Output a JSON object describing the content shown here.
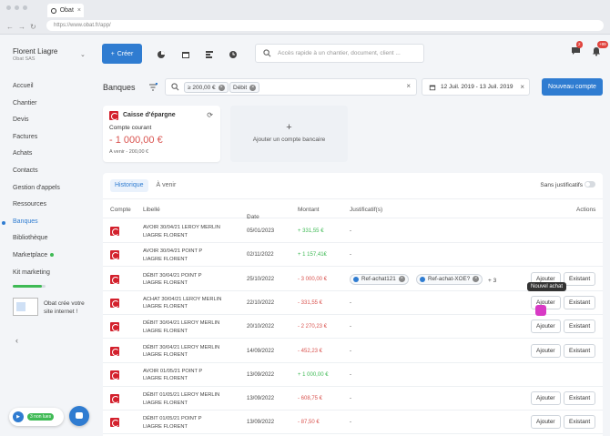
{
  "browser": {
    "tab_title": "Obat",
    "url": "https://www.obat.fr/app/"
  },
  "user": {
    "name": "Florent Liagre",
    "company": "Obat SAS"
  },
  "nav": [
    {
      "label": "Accueil"
    },
    {
      "label": "Chantier"
    },
    {
      "label": "Devis"
    },
    {
      "label": "Factures"
    },
    {
      "label": "Achats"
    },
    {
      "label": "Contacts"
    },
    {
      "label": "Gestion d'appels"
    },
    {
      "label": "Ressources"
    },
    {
      "label": "Banques"
    },
    {
      "label": "Bibliothèque"
    },
    {
      "label": "Marketplace"
    },
    {
      "label": "Kit marketing"
    }
  ],
  "kit_progress": 0.9,
  "promo": "Obat crée votre site internet !",
  "chat": {
    "badge": "3 non lues"
  },
  "topbar": {
    "create": "Créer",
    "search_placeholder": "Accès rapide à un chantier, document, client ...",
    "messages_badge": "2",
    "notif_badge": "+99"
  },
  "page": {
    "title": "Banques",
    "new_account": "Nouveau compte",
    "date_range": "12 Juil. 2019 - 13 Juil. 2019"
  },
  "filters": [
    {
      "label": "≥ 200,00 €"
    },
    {
      "label": "Débit"
    }
  ],
  "account_card": {
    "bank": "Caisse d'épargne",
    "type": "Compte courant",
    "balance": "- 1 000,00 €",
    "upcoming": "A venir - 200,00 €"
  },
  "add_card": {
    "label": "Ajouter un compte bancaire"
  },
  "tabs": {
    "history": "Historique",
    "upcoming": "À venir",
    "toggle_label": "Sans justificatifs"
  },
  "columns": {
    "account": "Compte",
    "label": "Libellé",
    "date": "Date",
    "amount": "Montant",
    "proof": "Justificatif(s)",
    "actions": "Actions"
  },
  "rows": [
    {
      "l1": "AVOIR 30/04/21 LEROY MERLIN",
      "l2": "LIAGRE FLORENT",
      "date": "05/01/2023",
      "amount": "+ 331,55 €",
      "proof": "-"
    },
    {
      "l1": "AVOIR 30/04/21 POINT P",
      "l2": "LIAGRE FLORENT",
      "date": "02/11/2022",
      "amount": "+ 1 157,41€",
      "proof": "-"
    },
    {
      "l1": "DÉBIT 30/04/21 POINT P",
      "l2": "LIAGRE FLORENT",
      "date": "25/10/2022",
      "amount": "- 3 000,00 €",
      "chip1": "Ref-achat121",
      "chip2": "Ref-achat-XOE?",
      "more": "+ 3",
      "add": "Ajouter",
      "existing": "Existant"
    },
    {
      "l1": "ACHAT 30/04/21 LEROY MERLIN",
      "l2": "LIAGRE FLORENT",
      "date": "22/10/2022",
      "amount": "- 331,55 €",
      "proof": "-",
      "add": "Ajouter",
      "existing": "Existant"
    },
    {
      "l1": "DÉBIT 30/04/21 LEROY MERLIN",
      "l2": "LIAGRE FLORENT",
      "date": "20/10/2022",
      "amount": "- 2 270,23 €",
      "proof": "-",
      "add": "Ajouter",
      "existing": "Existant"
    },
    {
      "l1": "DÉBIT 30/04/21 LEROY MERLIN",
      "l2": "LIAGRE FLORENT",
      "date": "14/09/2022",
      "amount": "- 452,23 €",
      "proof": "-",
      "add": "Ajouter",
      "existing": "Existant"
    },
    {
      "l1": "AVOIR 01/05/21 POINT P",
      "l2": "LIAGRE FLORENT",
      "date": "13/09/2022",
      "amount": "+ 1 000,00 €",
      "proof": "-"
    },
    {
      "l1": "DÉBIT 01/05/21 LEROY MERLIN",
      "l2": "LIAGRE FLORENT",
      "date": "13/09/2022",
      "amount": "- 608,75 €",
      "proof": "-",
      "add": "Ajouter",
      "existing": "Existant"
    },
    {
      "l1": "DÉBIT 01/05/21 POINT P",
      "l2": "LIAGRE FLORENT",
      "date": "13/09/2022",
      "amount": "- 87,50 €",
      "proof": "-",
      "add": "Ajouter",
      "existing": "Existant"
    }
  ],
  "tooltip": "Nouvel achat"
}
